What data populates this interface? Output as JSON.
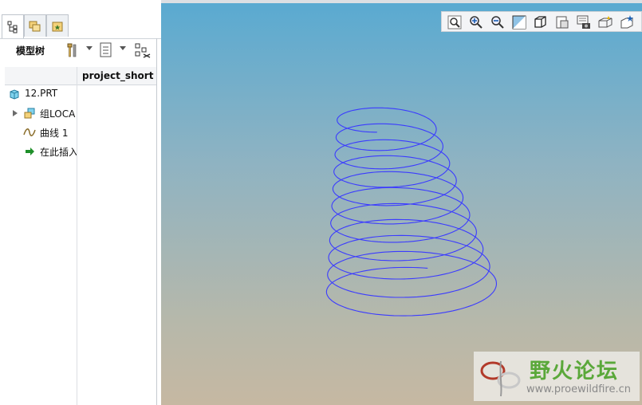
{
  "left_panel": {
    "tabs": [
      {
        "name": "model-tree-tab",
        "icon": "tree-icon",
        "active": true
      },
      {
        "name": "folder-browser-tab",
        "icon": "folders-icon",
        "active": false
      },
      {
        "name": "favorites-tab",
        "icon": "favorites-icon",
        "active": false
      }
    ],
    "toolbar": {
      "title": "模型树",
      "tools": [
        "settings-tools-icon",
        "tree-columns-icon",
        "filter-show-icon"
      ]
    },
    "columns": {
      "name": "",
      "project": "project_short"
    },
    "tree": [
      {
        "label": "12.PRT",
        "icon": "part-icon",
        "expandable": false
      },
      {
        "label": "组LOCA",
        "icon": "group-icon",
        "expandable": true
      },
      {
        "label": "曲线 1",
        "icon": "curve-icon",
        "expandable": false
      },
      {
        "label": "在此插入",
        "icon": "insert-here-icon",
        "expandable": false
      }
    ]
  },
  "graphics": {
    "colors": {
      "curve": "#3b3bff",
      "bg_top": "#5aaad1",
      "bg_bottom": "#c6b8a2"
    },
    "view_toolbar": [
      "refit-icon",
      "zoom-in-icon",
      "zoom-out-icon",
      "repaint-icon",
      "display-style-icon",
      "saved-views-icon",
      "view-manager-icon",
      "datum-display-icon",
      "spin-center-icon"
    ],
    "watermark": {
      "title": "野火论坛",
      "url": "www.proewildfire.cn"
    }
  }
}
